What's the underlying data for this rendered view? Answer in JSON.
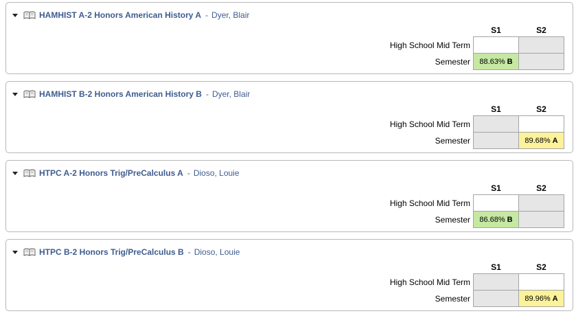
{
  "courses": [
    {
      "title": "HAMHIST A-2 Honors American History A",
      "separator": "-",
      "teacher": "Dyer, Blair",
      "terms": [
        "S1",
        "S2"
      ],
      "rows": [
        {
          "label": "High School Mid Term",
          "cells": [
            {
              "state": "empty",
              "pct": "",
              "letter": ""
            },
            {
              "state": "na",
              "pct": "",
              "letter": ""
            }
          ]
        },
        {
          "label": "Semester",
          "cells": [
            {
              "state": "green",
              "pct": "88.63%",
              "letter": "B"
            },
            {
              "state": "na",
              "pct": "",
              "letter": ""
            }
          ]
        }
      ]
    },
    {
      "title": "HAMHIST B-2 Honors American History B",
      "separator": "-",
      "teacher": "Dyer, Blair",
      "terms": [
        "S1",
        "S2"
      ],
      "rows": [
        {
          "label": "High School Mid Term",
          "cells": [
            {
              "state": "na",
              "pct": "",
              "letter": ""
            },
            {
              "state": "empty",
              "pct": "",
              "letter": ""
            }
          ]
        },
        {
          "label": "Semester",
          "cells": [
            {
              "state": "na",
              "pct": "",
              "letter": ""
            },
            {
              "state": "yellow",
              "pct": "89.68%",
              "letter": "A"
            }
          ]
        }
      ]
    },
    {
      "title": "HTPC A-2 Honors Trig/PreCalculus A",
      "separator": "-",
      "teacher": "Dioso, Louie",
      "terms": [
        "S1",
        "S2"
      ],
      "rows": [
        {
          "label": "High School Mid Term",
          "cells": [
            {
              "state": "empty",
              "pct": "",
              "letter": ""
            },
            {
              "state": "na",
              "pct": "",
              "letter": ""
            }
          ]
        },
        {
          "label": "Semester",
          "cells": [
            {
              "state": "green",
              "pct": "86.68%",
              "letter": "B"
            },
            {
              "state": "na",
              "pct": "",
              "letter": ""
            }
          ]
        }
      ]
    },
    {
      "title": "HTPC B-2 Honors Trig/PreCalculus B",
      "separator": "-",
      "teacher": "Dioso, Louie",
      "terms": [
        "S1",
        "S2"
      ],
      "rows": [
        {
          "label": "High School Mid Term",
          "cells": [
            {
              "state": "na",
              "pct": "",
              "letter": ""
            },
            {
              "state": "empty",
              "pct": "",
              "letter": ""
            }
          ]
        },
        {
          "label": "Semester",
          "cells": [
            {
              "state": "na",
              "pct": "",
              "letter": ""
            },
            {
              "state": "yellow",
              "pct": "89.96%",
              "letter": "A"
            }
          ]
        }
      ]
    }
  ],
  "icons": {
    "toggle": "triangle-down-icon",
    "course": "open-book-icon"
  },
  "colors": {
    "link": "#3e5c8f",
    "grade_b": "#c6e8a2",
    "grade_a": "#fbf29a",
    "not_applicable": "#e6e6e6",
    "border": "#b7b7b7"
  }
}
